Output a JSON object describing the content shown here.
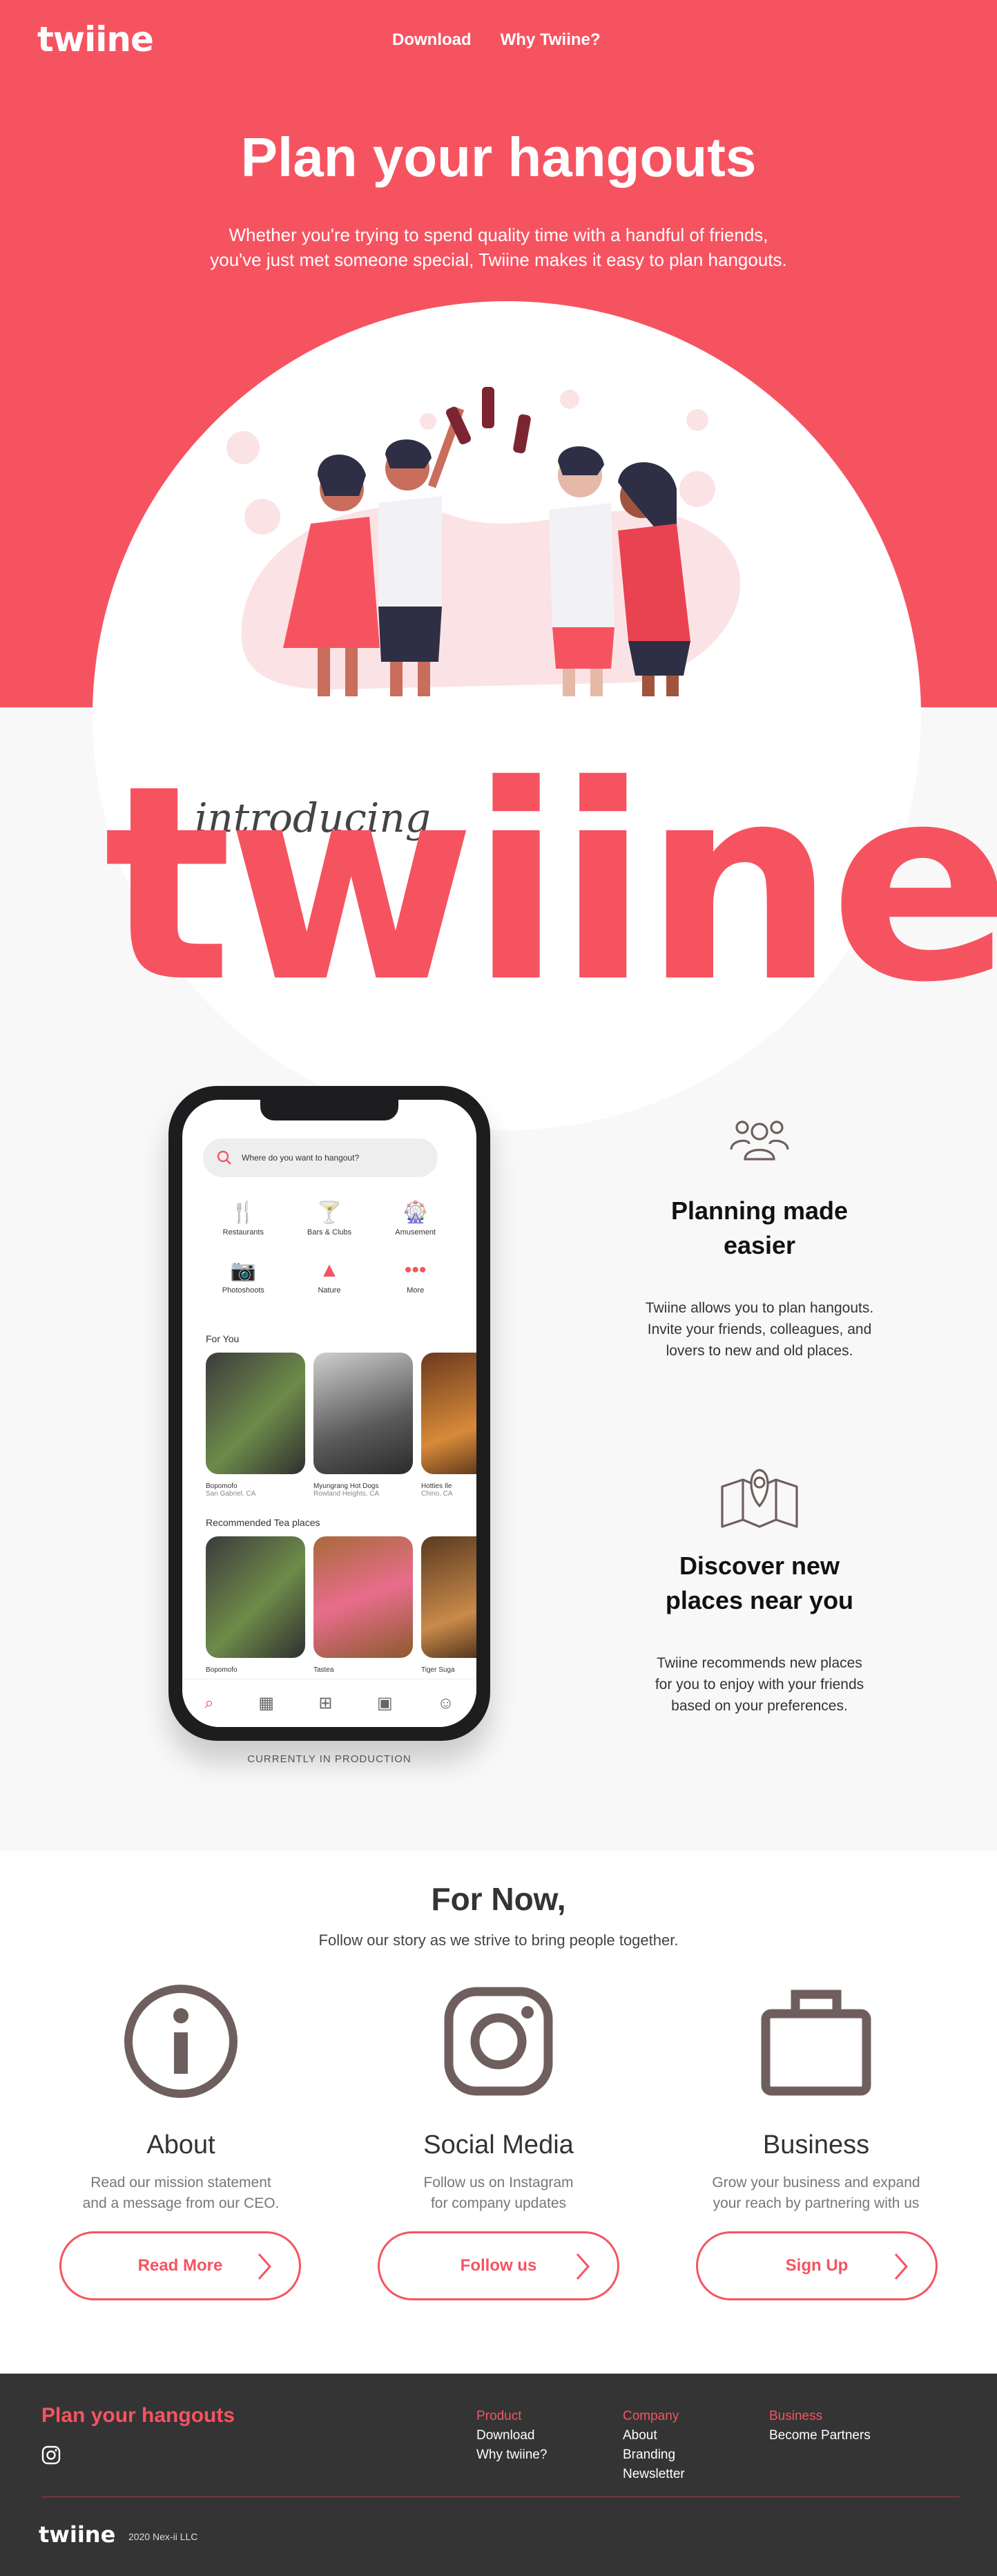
{
  "header": {
    "logo": "twiine",
    "nav": [
      "Download",
      "Why Twiine?"
    ]
  },
  "hero": {
    "title": "Plan your hangouts",
    "subtitle_line1": "Whether you're trying to spend quality time with a handful of friends,",
    "subtitle_line2": "you've just met someone special, Twiine makes it easy to plan hangouts."
  },
  "intro": {
    "introducing": "introducing",
    "word": "twiine"
  },
  "phone_app": {
    "search_placeholder": "Where do you want to hangout?",
    "categories": [
      "Restaurants",
      "Bars & Clubs",
      "Amusement",
      "Photoshoots",
      "Nature",
      "More"
    ],
    "for_you_title": "For You",
    "for_you": [
      {
        "name": "Bopomofo",
        "location": "San Gabriel, CA"
      },
      {
        "name": "Myungrang Hot Dogs",
        "location": "Rowland Heights, CA"
      },
      {
        "name": "Hotties Ile",
        "location": "Chino, CA"
      }
    ],
    "tea_title": "Recommended Tea places",
    "tea": [
      {
        "name": "Bopomofo"
      },
      {
        "name": "Tastea"
      },
      {
        "name": "Tiger Suga"
      }
    ],
    "production_note": "CURRENTLY IN PRODUCTION"
  },
  "features": [
    {
      "icon": "group-icon",
      "title_line1": "Planning made",
      "title_line2": "easier",
      "desc_line1": "Twiine allows you to plan hangouts.",
      "desc_line2": "Invite your friends, colleagues, and",
      "desc_line3": "lovers to new and old places."
    },
    {
      "icon": "map-pin-icon",
      "title_line1": "Discover new",
      "title_line2": "places near you",
      "desc_line1": "Twiine recommends new places",
      "desc_line2": "for you to enjoy with your friends",
      "desc_line3": "based on your preferences."
    }
  ],
  "for_now": {
    "title": "For Now,",
    "subtitle": "Follow our story as we strive to bring people together.",
    "columns": [
      {
        "title": "About",
        "desc_line1": "Read our mission statement",
        "desc_line2": "and a message from our CEO.",
        "button": "Read More"
      },
      {
        "title": "Social Media",
        "desc_line1": "Follow us on Instagram",
        "desc_line2": "for company updates",
        "button": "Follow us"
      },
      {
        "title": "Business",
        "desc_line1": "Grow your business and expand",
        "desc_line2": "your reach by partnering with us",
        "button": "Sign Up"
      }
    ]
  },
  "footer": {
    "tagline": "Plan your hangouts",
    "product": {
      "heading": "Product",
      "links": [
        "Download",
        "Why twiine?"
      ]
    },
    "company": {
      "heading": "Company",
      "links": [
        "About",
        "Branding",
        "Newsletter"
      ]
    },
    "business": {
      "heading": "Business",
      "links": [
        "Become Partners"
      ]
    },
    "logo": "twiine",
    "copyright": "2020 Nex-ii LLC"
  },
  "colors": {
    "brand": "#f65361",
    "footer_bg": "#343434",
    "icon_brown": "#6e5f5e"
  }
}
